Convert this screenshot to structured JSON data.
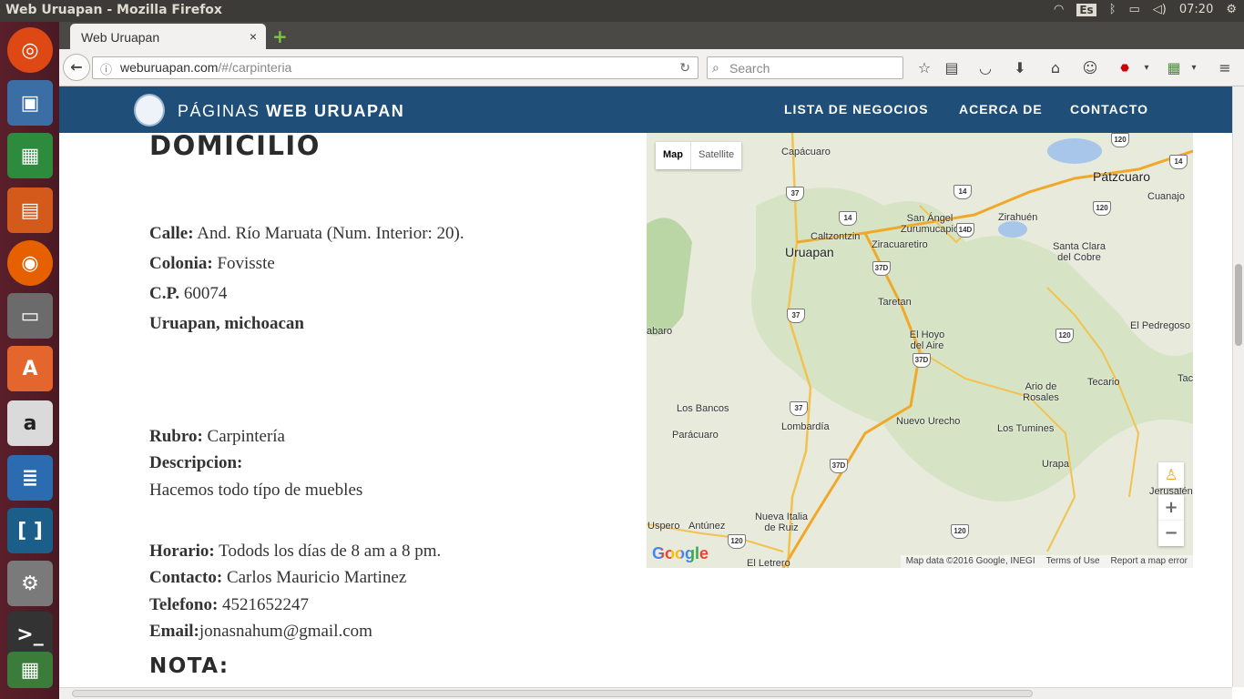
{
  "os": {
    "window_title": "Web Uruapan - Mozilla Firefox",
    "keyboard_layout": "Es",
    "clock": "07:20"
  },
  "browser": {
    "tab_title": "Web Uruapan",
    "tab_close": "×",
    "new_tab": "+",
    "url_domain": "weburuapan.com",
    "url_path": "/#/carpinteria",
    "search_placeholder": "Search"
  },
  "site": {
    "brand_light": "PÁGINAS ",
    "brand_bold": "WEB URUAPAN",
    "nav": [
      "LISTA DE NEGOCIOS",
      "ACERCA DE",
      "CONTACTO"
    ]
  },
  "business": {
    "section_title": "DOMICILIO",
    "calle_label": "Calle:",
    "calle_value": " And. Río Maruata (Num. Interior: 20).",
    "colonia_label": "Colonia:",
    "colonia_value": " Fovisste",
    "cp_label": "C.P.",
    "cp_value": " 60074",
    "city": "Uruapan, michoacan",
    "rubro_label": "Rubro:",
    "rubro_value": " Carpintería",
    "descripcion_label": "Descripcion:",
    "descripcion_value": "Hacemos todo típo de muebles",
    "horario_label": "Horario:",
    "horario_value": " Todods los días de 8 am a 8 pm.",
    "contacto_label": "Contacto:",
    "contacto_value": " Carlos Mauricio Martinez",
    "telefono_label": "Telefono:",
    "telefono_value": " 4521652247",
    "email_label": "Email:",
    "email_value": "jonasnahum@gmail.com",
    "nota_title": "NOTA:"
  },
  "map": {
    "type_map": "Map",
    "type_satellite": "Satellite",
    "places": [
      "Capácuaro",
      "Pátzcuaro",
      "Cuanajo",
      "San Ángel Zurumucapio",
      "Zirahuén",
      "Caltzontzin",
      "Uruapan",
      "Ziracuaretiro",
      "Santa Clara del Cobre",
      "Taretan",
      "El Hoyo del Aire",
      "El Pedregoso",
      "Los Bancos",
      "Ario de Rosales",
      "Tecario",
      "Tac",
      "Lombardía",
      "Nuevo Urecho",
      "Los Tumines",
      "Parácuaro",
      "Urapa",
      "Nueva Italia de Ruiz",
      "Antúnez",
      "Uspero",
      "El Letrero",
      "N Jerusalén",
      "abaro"
    ],
    "shields": [
      "37",
      "14",
      "14",
      "14D",
      "37D",
      "120",
      "37",
      "37D",
      "120",
      "37",
      "37D",
      "120",
      "120",
      "120",
      "14"
    ],
    "zoom_in": "+",
    "zoom_out": "−",
    "google_logo": "Google",
    "footer": [
      "Map data ©2016 Google, INEGI",
      "Terms of Use",
      "Report a map error"
    ]
  }
}
